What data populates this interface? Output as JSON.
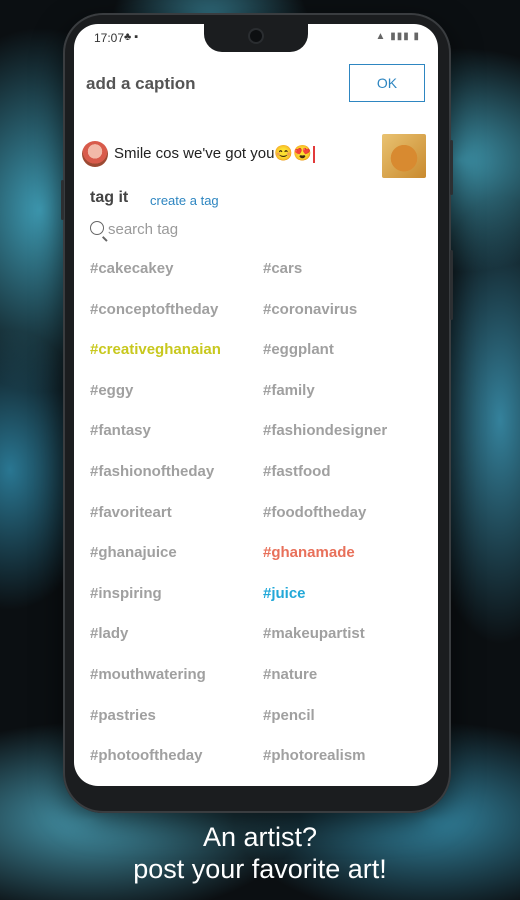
{
  "status_bar": {
    "time": "17:07"
  },
  "caption": {
    "title": "add a caption",
    "ok_label": "OK",
    "text": "Smile cos we've got you😊😍"
  },
  "tagging": {
    "title": "tag it",
    "create_label": "create a tag",
    "search_placeholder": "search tag"
  },
  "tags": [
    {
      "label": "#cakecakey",
      "color": "#a0a0a0"
    },
    {
      "label": "#cars",
      "color": "#a0a0a0"
    },
    {
      "label": "#conceptoftheday",
      "color": "#a0a0a0"
    },
    {
      "label": "#coronavirus",
      "color": "#a0a0a0"
    },
    {
      "label": "#creativeghanaian",
      "color": "#c8c81e"
    },
    {
      "label": "#eggplant",
      "color": "#a0a0a0"
    },
    {
      "label": "#eggy",
      "color": "#a0a0a0"
    },
    {
      "label": "#family",
      "color": "#a0a0a0"
    },
    {
      "label": "#fantasy",
      "color": "#a0a0a0"
    },
    {
      "label": "#fashiondesigner",
      "color": "#a0a0a0"
    },
    {
      "label": "#fashionoftheday",
      "color": "#a0a0a0"
    },
    {
      "label": "#fastfood",
      "color": "#a0a0a0"
    },
    {
      "label": "#favoriteart",
      "color": "#a0a0a0"
    },
    {
      "label": "#foodoftheday",
      "color": "#a0a0a0"
    },
    {
      "label": "#ghanajuice",
      "color": "#a0a0a0"
    },
    {
      "label": "#ghanamade",
      "color": "#e8705a"
    },
    {
      "label": "#inspiring",
      "color": "#a0a0a0"
    },
    {
      "label": "#juice",
      "color": "#22a8d8"
    },
    {
      "label": "#lady",
      "color": "#a0a0a0"
    },
    {
      "label": "#makeupartist",
      "color": "#a0a0a0"
    },
    {
      "label": "#mouthwatering",
      "color": "#a0a0a0"
    },
    {
      "label": "#nature",
      "color": "#a0a0a0"
    },
    {
      "label": "#pastries",
      "color": "#a0a0a0"
    },
    {
      "label": "#pencil",
      "color": "#a0a0a0"
    },
    {
      "label": "#photooftheday",
      "color": "#a0a0a0"
    },
    {
      "label": "#photorealism",
      "color": "#a0a0a0"
    }
  ],
  "promo": {
    "line1": "An artist?",
    "line2": "post your favorite art!"
  },
  "colors": {
    "accent": "#2e86c1"
  }
}
